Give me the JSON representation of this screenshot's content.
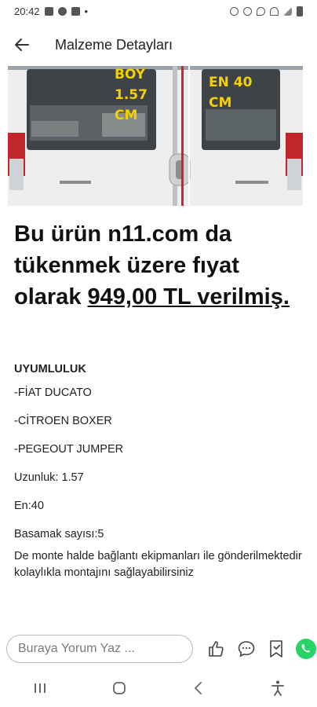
{
  "status": {
    "time": "20:42",
    "dot": "•"
  },
  "app_bar": {
    "title": "Malzeme Detayları"
  },
  "hero": {
    "label_left_1": "BOY",
    "label_left_2": "1.57",
    "label_left_3": "CM",
    "label_right_1": "EN 40",
    "label_right_2": "CM"
  },
  "headline": {
    "text_before": "Bu ürün n11.com da tükenmek üzere fıyat olarak ",
    "price": "949,00 TL verilmiş."
  },
  "content": {
    "compat_title": "UYUMLULUK",
    "lines": [
      "-FİAT DUCATO",
      "-CİTROEN BOXER",
      "-PEGEOUT JUMPER",
      "Uzunluk: 1.57",
      "En:40",
      "Basamak sayısı:5"
    ],
    "note": "De monte halde bağlantı ekipmanları ile gönderilmektedir kolaylıkla montajını sağlayabilirsiniz"
  },
  "comment": {
    "placeholder": "Buraya Yorum Yaz ..."
  },
  "icons": {
    "back": "arrow-left-icon",
    "like": "thumbs-up-icon",
    "comment": "chat-bubble-icon",
    "bookmark": "bookmark-icon",
    "whatsapp": "whatsapp-icon",
    "recents": "recents-icon",
    "home": "home-icon",
    "nav_back": "chevron-left-icon",
    "accessibility": "accessibility-icon"
  },
  "colors": {
    "whatsapp": "#25d366",
    "label_yellow": "#f5d100",
    "marker_red": "#e02020"
  }
}
